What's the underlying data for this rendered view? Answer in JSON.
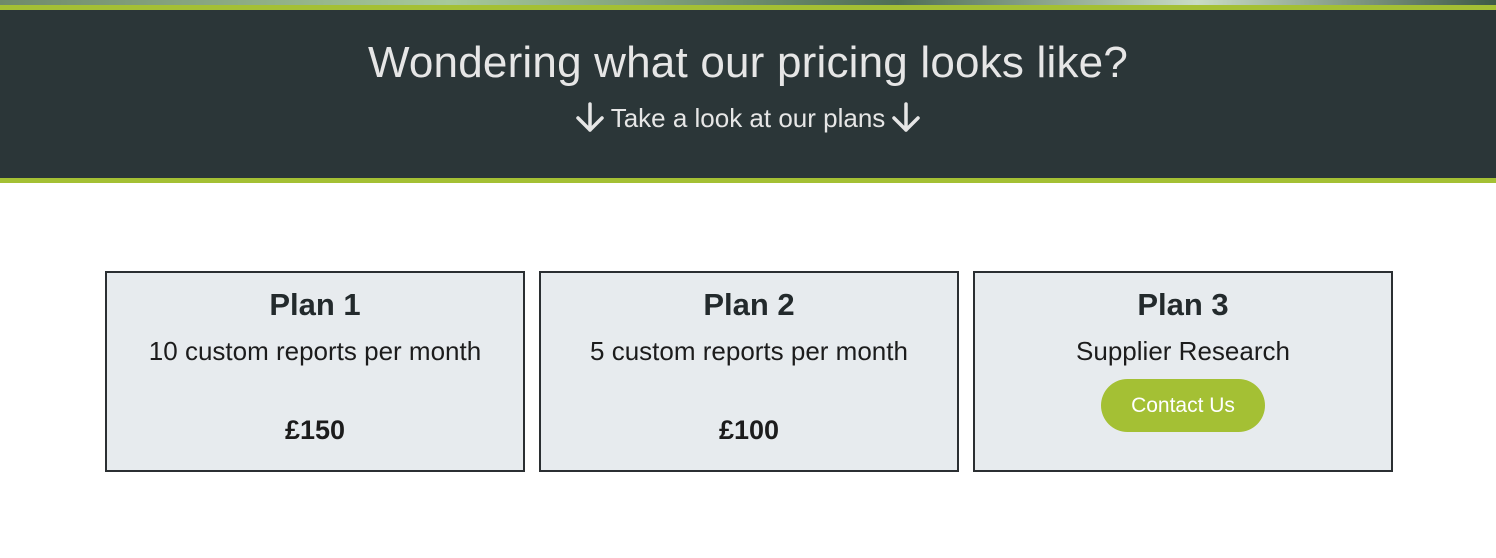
{
  "banner": {
    "title": "Wondering what our pricing looks like?",
    "subtitle": "Take a look at our plans",
    "left_icon": "arrow-down-icon",
    "right_icon": "arrow-down-icon"
  },
  "colors": {
    "banner_bg": "#2b3638",
    "accent": "#a4c034",
    "card_bg": "#e7ebee"
  },
  "plans": [
    {
      "name": "Plan 1",
      "description": "10 custom reports per month",
      "price": "£150"
    },
    {
      "name": "Plan 2",
      "description": "5 custom reports per month",
      "price": "£100"
    },
    {
      "name": "Plan 3",
      "description": "Supplier Research",
      "button_label": "Contact Us"
    }
  ]
}
